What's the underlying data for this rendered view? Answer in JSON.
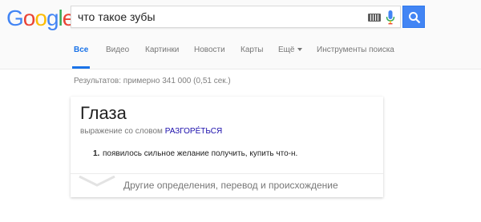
{
  "logo": {
    "letters": [
      {
        "ch": "G",
        "color": "#4285F4"
      },
      {
        "ch": "o",
        "color": "#EA4335"
      },
      {
        "ch": "o",
        "color": "#FBBC05"
      },
      {
        "ch": "g",
        "color": "#4285F4"
      },
      {
        "ch": "l",
        "color": "#34A853"
      },
      {
        "ch": "e",
        "color": "#EA4335"
      }
    ]
  },
  "search": {
    "value": "что такое зубы",
    "keyboard_icon": "keyboard-icon",
    "mic_icon": "mic-icon",
    "button_icon": "search-icon"
  },
  "tabs": [
    {
      "label": "Все",
      "active": true
    },
    {
      "label": "Видео",
      "active": false
    },
    {
      "label": "Картинки",
      "active": false
    },
    {
      "label": "Новости",
      "active": false
    },
    {
      "label": "Карты",
      "active": false
    },
    {
      "label": "Ещё",
      "active": false,
      "dropdown": true
    },
    {
      "label": "Инструменты поиска",
      "active": false
    }
  ],
  "result_stats": "Результатов: примерно 341 000 (0,51 сек.)",
  "card": {
    "word": "Глаза",
    "phrase_prefix": "выражение со словом",
    "phrase_link": "РАЗГОРЕ́ТЬСЯ",
    "definitions": [
      {
        "num": "1.",
        "text": "появилось сильное желание получить, купить что-н."
      }
    ],
    "expand_label": "Другие определения, перевод и происхождение",
    "expand_icon": "chevron-down-icon"
  },
  "colors": {
    "accent": "#1a73e8",
    "link": "#1a0dab",
    "search_button": "#4285f4"
  }
}
